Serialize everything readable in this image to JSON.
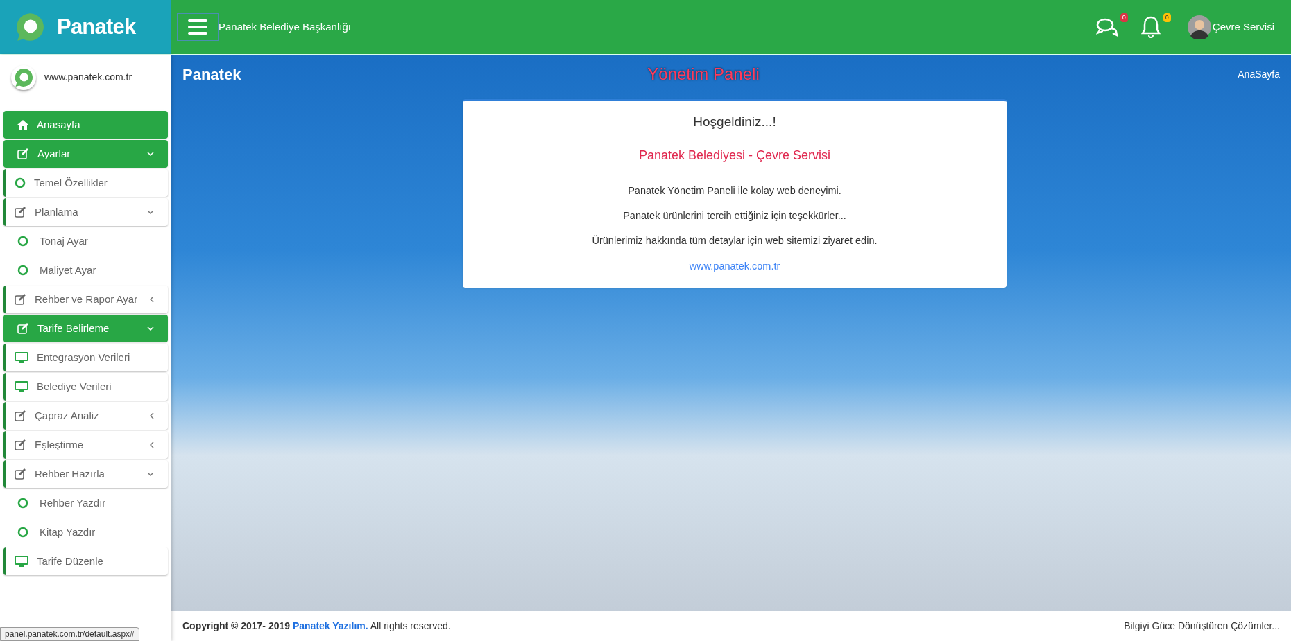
{
  "brand": {
    "logo_text": "Panatek"
  },
  "topbar": {
    "org_title": "Panatek Belediye Başkanlığı",
    "messages_badge": "0",
    "notifications_badge": "0",
    "user_name": "Çevre Servisi"
  },
  "sidebar": {
    "site_link": "www.panatek.com.tr",
    "items": [
      {
        "label": "Anasayfa",
        "kind": "home"
      },
      {
        "label": "Ayarlar",
        "kind": "section",
        "expanded": true
      },
      {
        "label": "Temel Özellikler",
        "kind": "link"
      },
      {
        "label": "Planlama",
        "kind": "group",
        "expanded": true
      },
      {
        "label": "Tonaj Ayar",
        "kind": "page"
      },
      {
        "label": "Maliyet Ayar",
        "kind": "page"
      },
      {
        "label": "Rehber ve Rapor Ayar",
        "kind": "group",
        "expanded": false
      },
      {
        "label": "Tarife Belirleme",
        "kind": "section",
        "expanded": true
      },
      {
        "label": "Entegrasyon Verileri",
        "kind": "data"
      },
      {
        "label": "Belediye Verileri",
        "kind": "data"
      },
      {
        "label": "Çapraz Analiz",
        "kind": "group",
        "expanded": false
      },
      {
        "label": "Eşleştirme",
        "kind": "group",
        "expanded": false
      },
      {
        "label": "Rehber Hazırla",
        "kind": "group",
        "expanded": true
      },
      {
        "label": "Rehber Yazdır",
        "kind": "page"
      },
      {
        "label": "Kitap Yazdır",
        "kind": "page"
      },
      {
        "label": "Tarife Düzenle",
        "kind": "data"
      }
    ]
  },
  "content": {
    "logo_text": "Panatek",
    "page_title": "Yönetim Paneli",
    "breadcrumb": "AnaSayfa",
    "welcome_card": {
      "title": "Hoşgeldiniz...!",
      "subtitle": "Panatek Belediyesi - Çevre Servisi",
      "lines": [
        "Panatek Yönetim Paneli ile kolay web deneyimi.",
        "Panatek ürünlerini tercih ettiğiniz için teşekkürler...",
        "Ürünlerimiz hakkında tüm detaylar için web sitemizi ziyaret edin."
      ],
      "link": "www.panatek.com.tr"
    }
  },
  "footer": {
    "copyright": "**Copyright © 2017- 2019** ",
    "company_link": "Panatek Yazılım.",
    "rights": " All rights reserved.",
    "slogan": "Bilgiyi Güce Dönüştüren Çözümler..."
  },
  "status_url": "panel.panatek.com.tr/default.aspx#"
}
